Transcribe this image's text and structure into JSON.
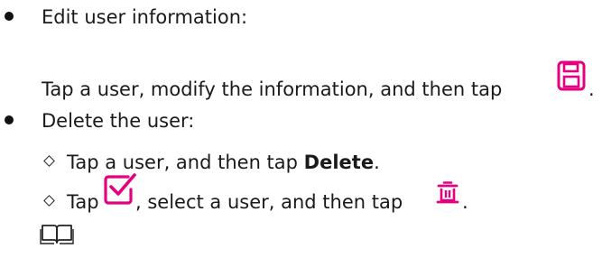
{
  "items": [
    {
      "heading": "Edit user information:",
      "detail": {
        "before_icon": "Tap a user, modify the information, and then tap",
        "icon": "save-icon",
        "after_icon": "."
      }
    },
    {
      "heading": "Delete the user:",
      "subitems": [
        {
          "text_before": "Tap a user, and then tap ",
          "bold": "Delete",
          "text_after": "."
        },
        {
          "text_before": "Tap",
          "icon1": "checkbox-icon",
          "text_middle": ", select a user, and then tap",
          "icon2": "trash-icon",
          "text_after": "."
        }
      ]
    }
  ],
  "note_icon": "book-icon",
  "colors": {
    "icon": "#e4007f",
    "text": "#1a1a1a"
  }
}
